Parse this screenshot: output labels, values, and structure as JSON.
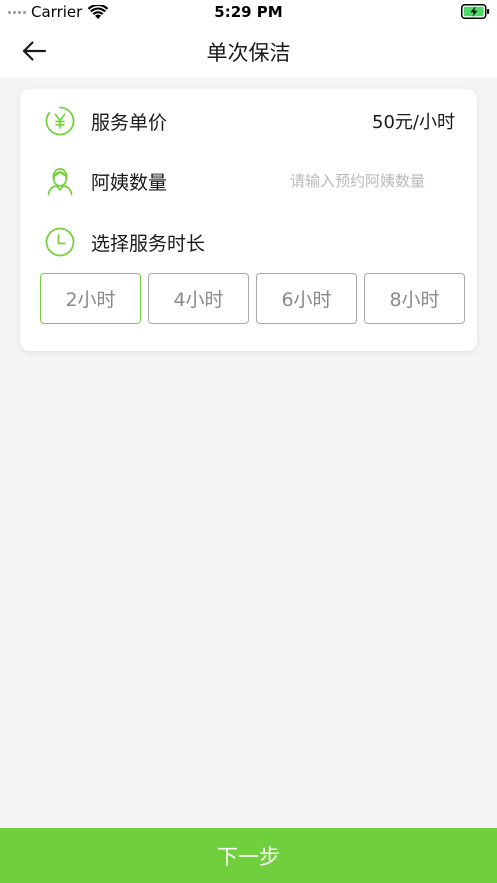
{
  "status_bar": {
    "carrier": "Carrier",
    "time": "5:29 PM",
    "icons": [
      "signal-dots",
      "wifi-icon",
      "battery-charging-icon"
    ]
  },
  "nav": {
    "title": "单次保洁",
    "back_icon": "arrow-left-icon"
  },
  "colors": {
    "accent": "#74d13d",
    "button_bg": "#6fcf3c",
    "page_bg": "#f4f5f7",
    "option_border": "#a8a8a8"
  },
  "card": {
    "price": {
      "icon": "yen-icon",
      "label": "服务单价",
      "value": "50元/小时"
    },
    "aunt_count": {
      "icon": "aunt-avatar-icon",
      "label": "阿姨数量",
      "placeholder": "请输入预约阿姨数量",
      "value": ""
    },
    "duration": {
      "icon": "clock-icon",
      "label": "选择服务时长",
      "options": [
        "2小时",
        "4小时",
        "6小时",
        "8小时"
      ],
      "selected": "2小时"
    }
  },
  "footer": {
    "next_label": "下一步"
  }
}
